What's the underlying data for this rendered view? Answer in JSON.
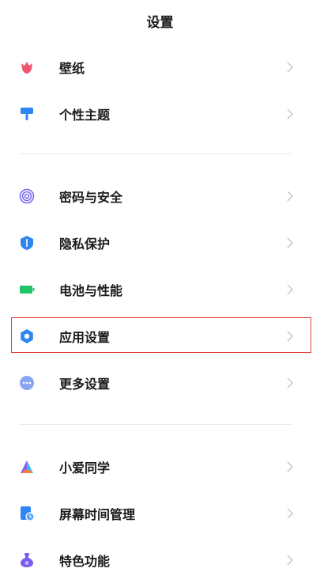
{
  "header": {
    "title": "设置"
  },
  "sections": [
    {
      "items": [
        {
          "name": "wallpaper",
          "label": "壁纸",
          "icon": "tulip-icon",
          "color": "#f0566f"
        },
        {
          "name": "theme",
          "label": "个性主题",
          "icon": "paint-roller-icon",
          "color": "#2e86f0"
        }
      ]
    },
    {
      "items": [
        {
          "name": "password-security",
          "label": "密码与安全",
          "icon": "fingerprint-icon",
          "color": "#7a6cf0"
        },
        {
          "name": "privacy",
          "label": "隐私保护",
          "icon": "shield-icon",
          "color": "#2e86f0"
        },
        {
          "name": "battery",
          "label": "电池与性能",
          "icon": "battery-icon",
          "color": "#22c46a"
        },
        {
          "name": "app-settings",
          "label": "应用设置",
          "icon": "gear-icon",
          "color": "#2e86f0",
          "highlighted": true,
          "highlight_color": "#e2403a"
        },
        {
          "name": "more-settings",
          "label": "更多设置",
          "icon": "more-dots-icon",
          "color": "#8aa6f2"
        }
      ]
    },
    {
      "items": [
        {
          "name": "xiaoai",
          "label": "小爱同学",
          "icon": "xiaoai-icon",
          "color": "#ff7a3d"
        },
        {
          "name": "screen-time",
          "label": "屏幕时间管理",
          "icon": "hourglass-doc-icon",
          "color": "#2e86f0"
        },
        {
          "name": "special-features",
          "label": "特色功能",
          "icon": "flask-icon",
          "color": "#7a5cf0"
        }
      ]
    }
  ]
}
